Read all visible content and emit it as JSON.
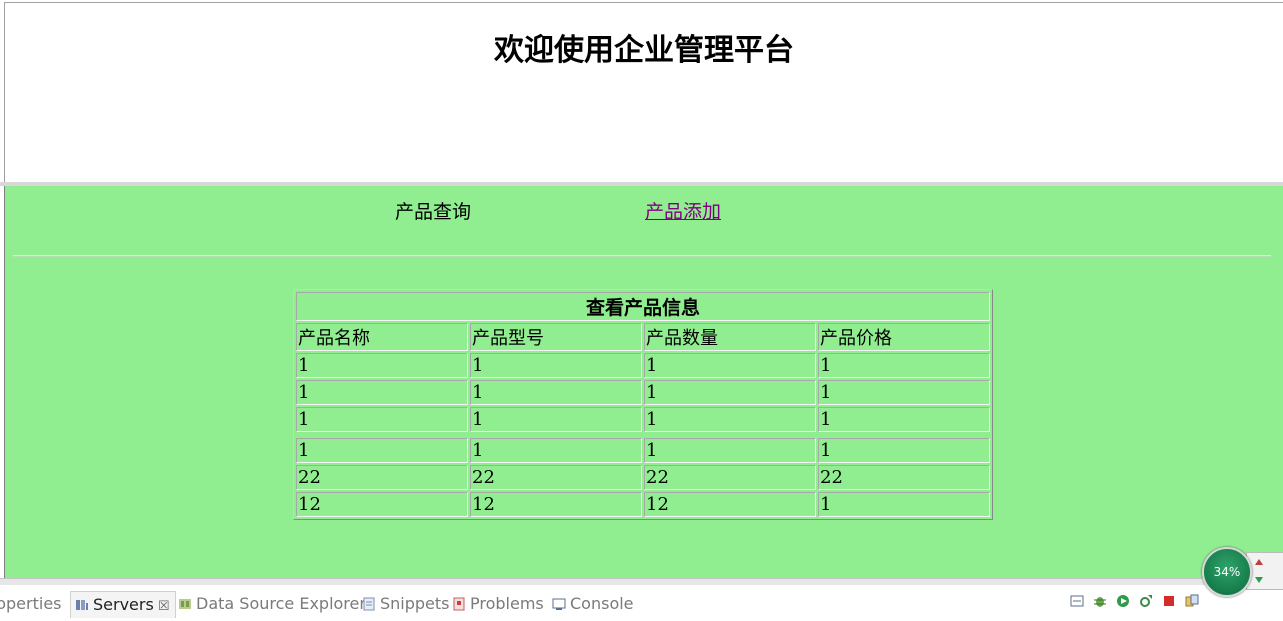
{
  "header": {
    "title": "欢迎使用企业管理平台"
  },
  "nav": {
    "query_label": "产品查询",
    "add_label": "产品添加"
  },
  "table": {
    "caption": "查看产品信息",
    "columns": [
      "产品名称",
      "产品型号",
      "产品数量",
      "产品价格"
    ],
    "rows_a": [
      [
        "1",
        "1",
        "1",
        "1"
      ],
      [
        "1",
        "1",
        "1",
        "1"
      ],
      [
        "1",
        "1",
        "1",
        "1"
      ]
    ],
    "rows_b": [
      [
        "1",
        "1",
        "1",
        "1"
      ],
      [
        "22",
        "22",
        "22",
        "22"
      ],
      [
        "12",
        "12",
        "12",
        "1"
      ]
    ]
  },
  "ide_panel": {
    "tabs": {
      "properties": "roperties",
      "servers": "Servers",
      "data_source_explorer": "Data Source Explorer",
      "snippets": "Snippets",
      "problems": "Problems",
      "console": "Console"
    },
    "close_glyph": "☒",
    "memory_gauge": "34%"
  },
  "colors": {
    "frame_bg": "#90ee90",
    "visited_link": "#800080"
  }
}
